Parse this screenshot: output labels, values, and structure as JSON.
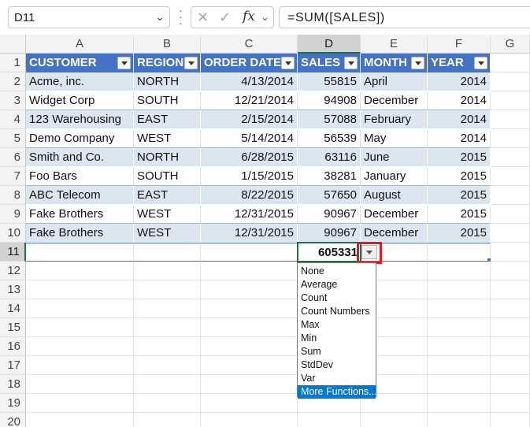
{
  "formula_bar": {
    "name_box": "D11",
    "formula": "=SUM([SALES])",
    "cancel_icon": "✕",
    "enter_icon": "✓",
    "fx_icon": "fx"
  },
  "columns": [
    "A",
    "B",
    "C",
    "D",
    "E",
    "F",
    "G"
  ],
  "rows": [
    "1",
    "2",
    "3",
    "4",
    "5",
    "6",
    "7",
    "8",
    "9",
    "10",
    "11",
    "12",
    "13",
    "14",
    "15",
    "16",
    "17",
    "18",
    "19",
    "20"
  ],
  "table": {
    "headers": [
      "CUSTOMER",
      "REGION",
      "ORDER DATE",
      "SALES",
      "MONTH",
      "YEAR"
    ],
    "rows": [
      [
        "Acme, inc.",
        "NORTH",
        "4/13/2014",
        "55815",
        "April",
        "2014"
      ],
      [
        "Widget Corp",
        "SOUTH",
        "12/21/2014",
        "94908",
        "December",
        "2014"
      ],
      [
        "123 Warehousing",
        "EAST",
        "2/15/2014",
        "57088",
        "February",
        "2014"
      ],
      [
        "Demo Company",
        "WEST",
        "5/14/2014",
        "56539",
        "May",
        "2014"
      ],
      [
        "Smith and Co.",
        "NORTH",
        "6/28/2015",
        "63116",
        "June",
        "2015"
      ],
      [
        "Foo Bars",
        "SOUTH",
        "1/15/2015",
        "38281",
        "January",
        "2015"
      ],
      [
        "ABC Telecom",
        "EAST",
        "8/22/2015",
        "57650",
        "August",
        "2015"
      ],
      [
        "Fake Brothers",
        "WEST",
        "12/31/2015",
        "90967",
        "December",
        "2015"
      ],
      [
        "Fake Brothers",
        "WEST",
        "12/31/2015",
        "90967",
        "December",
        "2015"
      ]
    ],
    "total_sales": "605331"
  },
  "total_menu": {
    "items": [
      "None",
      "Average",
      "Count",
      "Count Numbers",
      "Max",
      "Min",
      "Sum",
      "StdDev",
      "Var",
      "More Functions..."
    ],
    "highlighted_index": 9
  },
  "colors": {
    "header_blue": "#4472c4",
    "band_blue": "#dce6f1",
    "selection_green": "#217346",
    "callout_red": "#e0191f",
    "menu_highlight": "#0078d7"
  }
}
